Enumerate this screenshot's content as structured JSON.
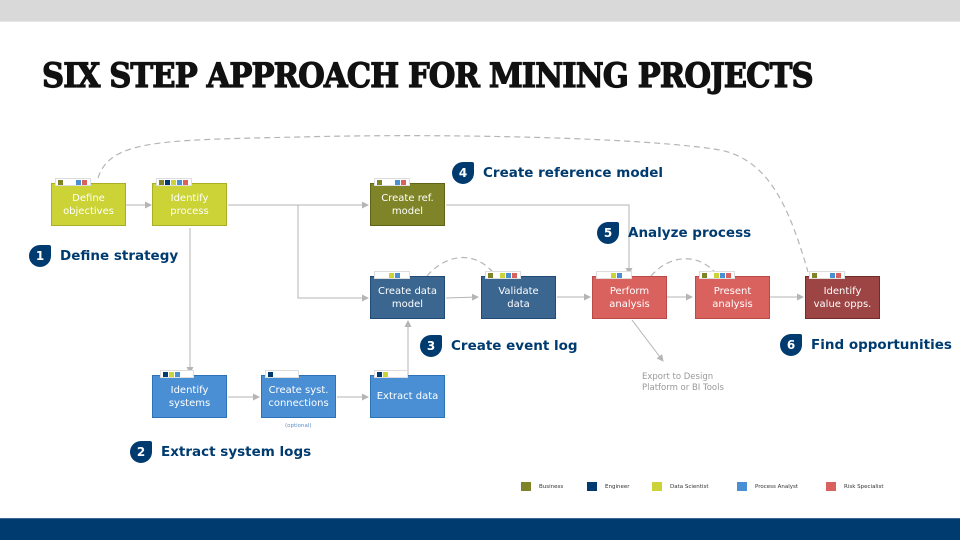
{
  "title": "SIX STEP APPROACH FOR MINING PROJECTS",
  "roles": {
    "business": {
      "label": "Business",
      "color": "#7e8427"
    },
    "engineer": {
      "label": "Engineer",
      "color": "#003b70"
    },
    "data_scientist": {
      "label": "Data Scientist",
      "color": "#cbd336"
    },
    "process_analyst": {
      "label": "Process Analyst",
      "color": "#4a8fd4"
    },
    "risk_specialist": {
      "label": "Risk Specialist",
      "color": "#d9625f"
    }
  },
  "steps": [
    {
      "number": "1",
      "label": "Define strategy"
    },
    {
      "number": "2",
      "label": "Extract system logs"
    },
    {
      "number": "3",
      "label": "Create event log"
    },
    {
      "number": "4",
      "label": "Create reference model"
    },
    {
      "number": "5",
      "label": "Analyze process"
    },
    {
      "number": "6",
      "label": "Find opportunities"
    }
  ],
  "nodes": [
    {
      "id": "define-objectives",
      "label": "Define\nobjectives",
      "roles": [
        "business",
        null,
        null,
        "process_analyst",
        "risk_specialist"
      ]
    },
    {
      "id": "identify-process",
      "label": "Identify\nprocess",
      "roles": [
        "business",
        "engineer",
        "data_scientist",
        "process_analyst",
        "risk_specialist"
      ]
    },
    {
      "id": "create-ref-model",
      "label": "Create ref.\nmodel",
      "roles": [
        "business",
        null,
        null,
        "process_analyst",
        "risk_specialist"
      ]
    },
    {
      "id": "create-data-model",
      "label": "Create data\nmodel",
      "roles": [
        null,
        null,
        "data_scientist",
        "process_analyst",
        null
      ]
    },
    {
      "id": "validate-data",
      "label": "Validate data",
      "roles": [
        "business",
        null,
        "data_scientist",
        "process_analyst",
        "risk_specialist"
      ]
    },
    {
      "id": "perform-analysis",
      "label": "Perform\nanalysis",
      "roles": [
        null,
        null,
        "data_scientist",
        "process_analyst",
        null
      ]
    },
    {
      "id": "present-analysis",
      "label": "Present\nanalysis",
      "roles": [
        "business",
        null,
        "data_scientist",
        "process_analyst",
        "risk_specialist"
      ]
    },
    {
      "id": "identify-value-opps",
      "label": "Identify\nvalue opps.",
      "roles": [
        "business",
        null,
        null,
        "process_analyst",
        "risk_specialist"
      ]
    },
    {
      "id": "identify-systems",
      "label": "Identify\nsystems",
      "roles": [
        "engineer",
        "data_scientist",
        "process_analyst"
      ]
    },
    {
      "id": "create-syst-connections",
      "label": "Create syst.\nconnections",
      "roles": [
        "engineer"
      ]
    },
    {
      "id": "extract-data",
      "label": "Extract data",
      "roles": [
        "engineer",
        "data_scientist"
      ]
    }
  ],
  "notes": {
    "optional": "(optional)",
    "export": "Export to Design\nPlatform or BI Tools"
  },
  "legend": [
    {
      "role": "business",
      "label": "Business"
    },
    {
      "role": "engineer",
      "label": "Engineer"
    },
    {
      "role": "data_scientist",
      "label": "Data Scientist"
    },
    {
      "role": "process_analyst",
      "label": "Process Analyst"
    },
    {
      "role": "risk_specialist",
      "label": "Risk Specialist"
    }
  ]
}
